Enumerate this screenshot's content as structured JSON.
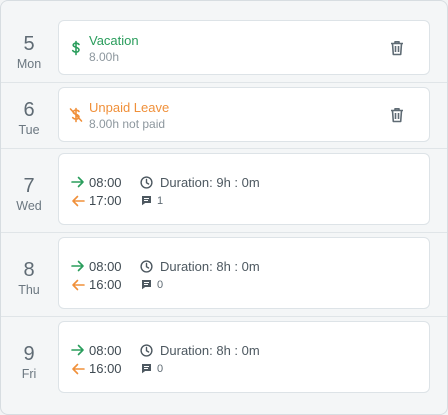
{
  "days": [
    {
      "num": "5",
      "name": "Mon",
      "type": "absence",
      "label": "Vacation",
      "detail": "8.00h",
      "icon": "dollar-icon",
      "color": "#2a9d5c"
    },
    {
      "num": "6",
      "name": "Tue",
      "type": "absence",
      "label": "Unpaid Leave",
      "detail": "8.00h not paid",
      "icon": "dollar-off-icon",
      "color": "#f0903a"
    },
    {
      "num": "7",
      "name": "Wed",
      "type": "work",
      "in": "08:00",
      "out": "17:00",
      "duration": "Duration: 9h : 0m",
      "comments": "1"
    },
    {
      "num": "8",
      "name": "Thu",
      "type": "work",
      "in": "08:00",
      "out": "16:00",
      "duration": "Duration: 8h : 0m",
      "comments": "0"
    },
    {
      "num": "9",
      "name": "Fri",
      "type": "work",
      "in": "08:00",
      "out": "16:00",
      "duration": "Duration: 8h : 0m",
      "comments": "0"
    }
  ],
  "colors": {
    "in_arrow": "#2a9d5c",
    "out_arrow": "#f0903a"
  }
}
